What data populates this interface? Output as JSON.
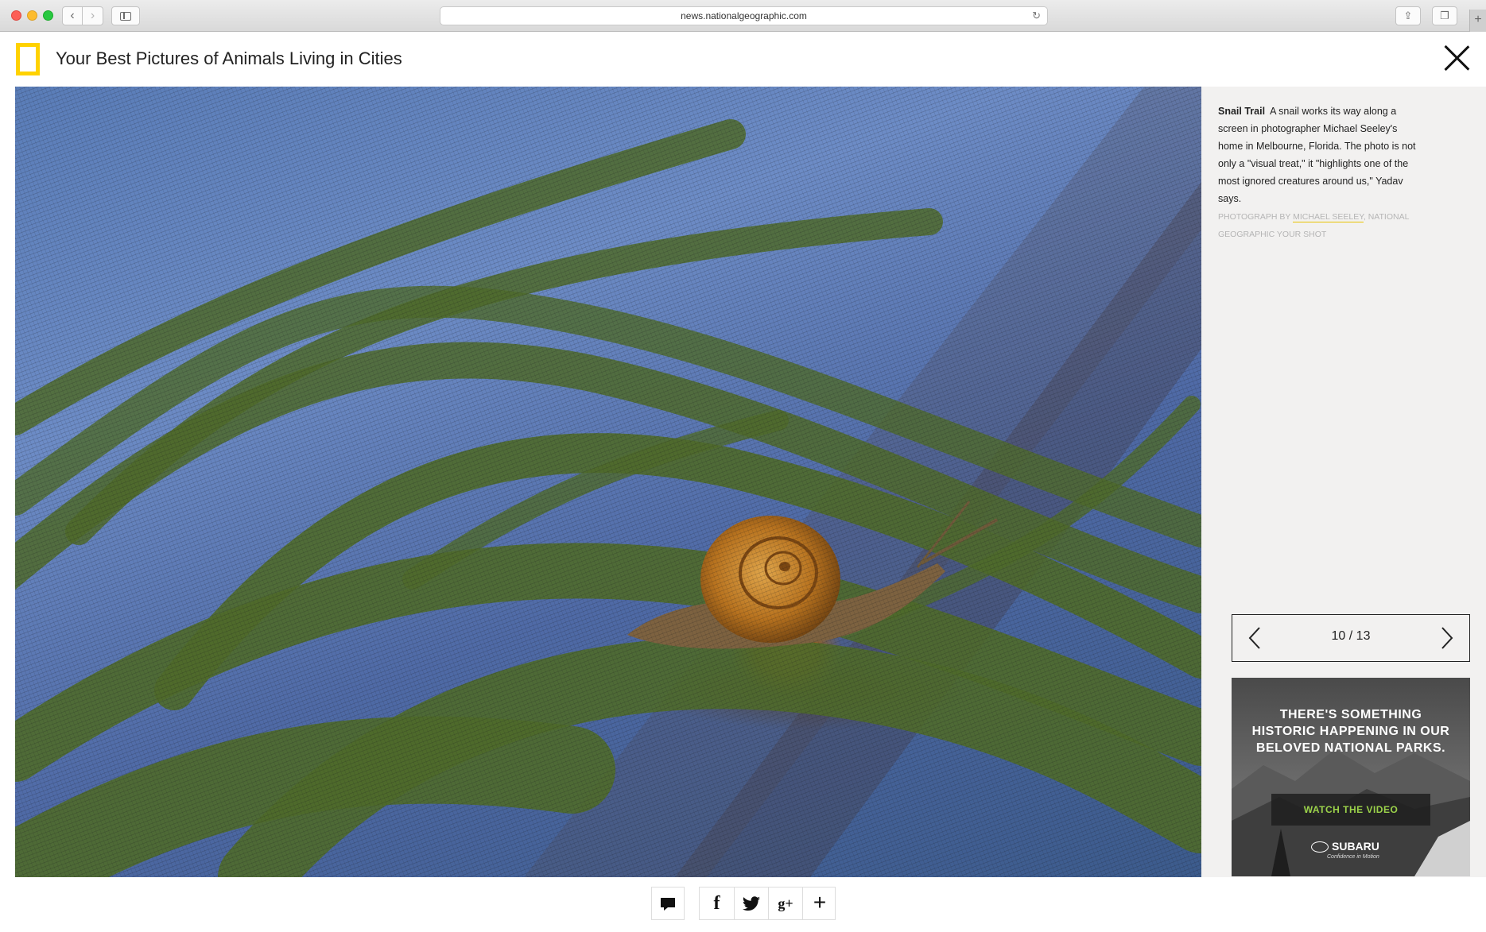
{
  "browser": {
    "url": "news.nationalgeographic.com"
  },
  "header": {
    "title": "Your Best Pictures of Animals Living in Cities"
  },
  "photo": {
    "subject": "snail-on-screen-photo"
  },
  "caption": {
    "title": "Snail Trail",
    "text": "A snail works its way along a screen in photographer Michael Seeley's home in Melbourne, Florida. The photo is not only a \"visual treat,\" it \"highlights one of the most ignored creatures around us,\" Yadav says.",
    "credit_prefix": "PHOTOGRAPH BY ",
    "credit_name": "MICHAEL SEELEY",
    "credit_suffix": ", NATIONAL GEOGRAPHIC YOUR SHOT"
  },
  "pager": {
    "counter": "10 / 13"
  },
  "ad": {
    "headline": "THERE'S SOMETHING HISTORIC HAPPENING IN OUR BELOVED NATIONAL PARKS.",
    "cta": "WATCH THE VIDEO",
    "brand": "SUBARU",
    "tagline": "Confidence in Motion"
  },
  "toolbar": {
    "facebook": "f",
    "googleplus": "g+",
    "more": "+"
  }
}
